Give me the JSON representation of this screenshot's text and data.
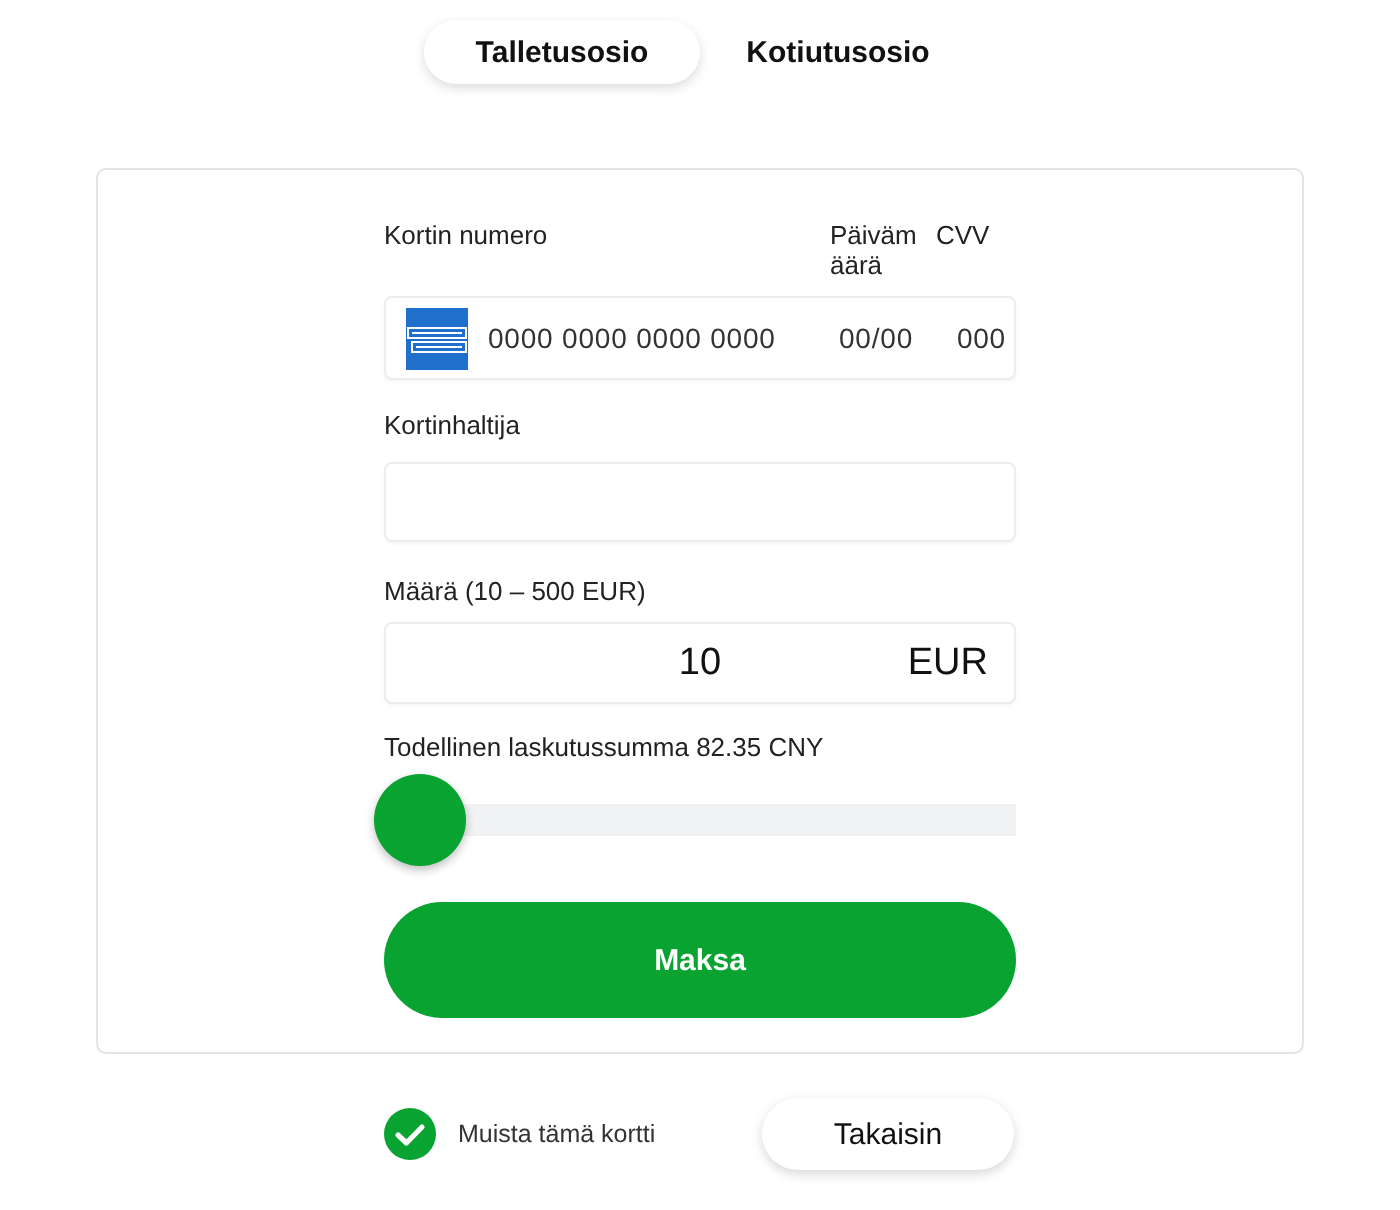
{
  "tabs": [
    {
      "label": "Talletusosio",
      "selected": true
    },
    {
      "label": "Kotiutusosio",
      "selected": false
    }
  ],
  "card_number": {
    "label": "Kortin numero",
    "placeholder": "0000 0000 0000 0000"
  },
  "expiry": {
    "label": "Päivämäärä",
    "placeholder": "00/00"
  },
  "cvv": {
    "label": "CVV",
    "placeholder": "000"
  },
  "cardholder": {
    "label": "Kortinhaltija"
  },
  "amount": {
    "label": "Määrä (10 – 500 EUR)",
    "value": "10",
    "currency": "EUR"
  },
  "billing_note": "Todellinen laskutussumma 82.35 CNY",
  "slider": {
    "level": 0
  },
  "pay_button": "Maksa",
  "remember_card": {
    "label": "Muista tämä kortti",
    "checked": true
  },
  "back_button": "Takaisin"
}
